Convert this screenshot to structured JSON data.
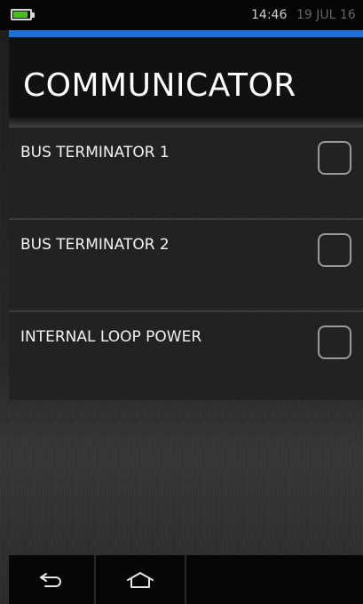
{
  "status_bar": {
    "battery_level": 0.9,
    "battery_color": "#46c11c",
    "time": "14:46",
    "date": "19 JUL 16"
  },
  "accent_color": "#1b6fd6",
  "page": {
    "title": "COMMUNICATOR"
  },
  "options": [
    {
      "label": "BUS TERMINATOR 1",
      "checked": false
    },
    {
      "label": "BUS TERMINATOR 2",
      "checked": false
    },
    {
      "label": "INTERNAL LOOP POWER",
      "checked": false
    }
  ],
  "nav": {
    "back_icon": "back-arrow-icon",
    "home_icon": "home-icon"
  }
}
